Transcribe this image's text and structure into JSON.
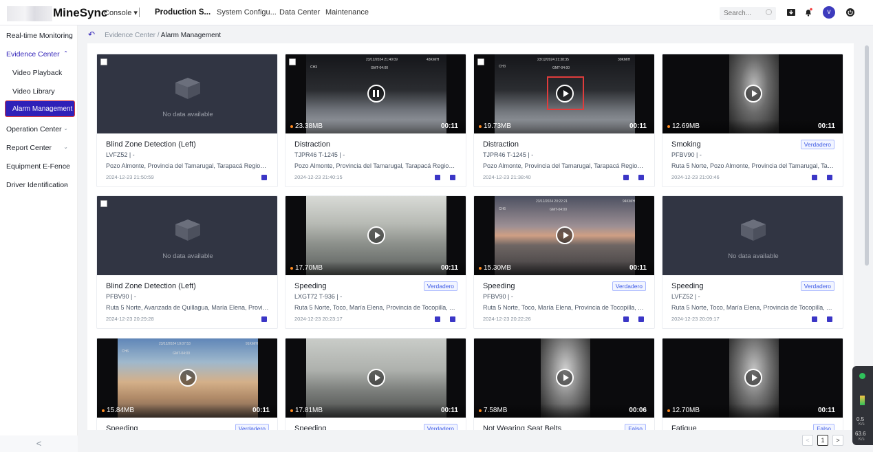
{
  "app": {
    "brand": "MineSync"
  },
  "topnav": {
    "console": "Console ▾",
    "production": "Production S...",
    "system": "System Configu...",
    "datacenter": "Data Center",
    "maintenance": "Maintenance",
    "search_placeholder": "Search...",
    "avatar": "v"
  },
  "sidebar": {
    "items": [
      {
        "label": "Real-time Monitoring"
      },
      {
        "label": "Evidence Center"
      },
      {
        "label": "Video Playback"
      },
      {
        "label": "Video Library"
      },
      {
        "label": "Alarm Management"
      },
      {
        "label": "Operation Center"
      },
      {
        "label": "Report Center"
      },
      {
        "label": "Equipment E-Fence"
      },
      {
        "label": "Driver Identification"
      }
    ],
    "collapse": "<"
  },
  "breadcrumb": {
    "parent": "Evidence Center",
    "sep": "/",
    "current": "Alarm Management"
  },
  "cards": [
    {
      "title": "Blind Zone Detection (Left)",
      "plate": "LVFZ52  |  -",
      "loc": "Pozo Almonte, Provincia del Tamarugal, Tarapacá Region, Ch...",
      "time": "2024-12-23 21:50:59",
      "nodata": "No data available"
    },
    {
      "title": "Distraction",
      "plate": "TJPR46 T-1245  |  -",
      "loc": "Pozo Almonte, Provincia del Tamarugal, Tarapacá Region, Ch...",
      "time": "2024-12-23 21:40:15",
      "size": "23.38MB",
      "dur": "00:11"
    },
    {
      "title": "Distraction",
      "plate": "TJPR46 T-1245  |  -",
      "loc": "Pozo Almonte, Provincia del Tamarugal, Tarapacá Region, Ch...",
      "time": "2024-12-23 21:38:40",
      "size": "19.73MB",
      "dur": "00:11"
    },
    {
      "title": "Smoking",
      "plate": "PFBV90  |  -",
      "loc": "Ruta 5 Norte, Pozo Almonte, Provincia del Tamarugal, Tarapa...",
      "time": "2024-12-23 21:00:46",
      "size": "12.69MB",
      "dur": "00:11",
      "badge": "Verdadero"
    },
    {
      "title": "Blind Zone Detection (Left)",
      "plate": "PFBV90  |  -",
      "loc": "Ruta 5 Norte, Avanzada de Quillagua, María Elena, Provincia ...",
      "time": "2024-12-23 20:29:28",
      "nodata": "No data available"
    },
    {
      "title": "Speeding",
      "plate": "LXGT72 T-936  |  -",
      "loc": "Ruta 5 Norte, Toco, María Elena, Provincia de Tocopilla, Anto...",
      "time": "2024-12-23 20:23:17",
      "size": "17.70MB",
      "dur": "00:11",
      "badge": "Verdadero"
    },
    {
      "title": "Speeding",
      "plate": "PFBV90  |  -",
      "loc": "Ruta 5 Norte, Toco, María Elena, Provincia de Tocopilla, Anto...",
      "time": "2024-12-23 20:22:26",
      "size": "15.30MB",
      "dur": "00:11",
      "badge": "Verdadero"
    },
    {
      "title": "Speeding",
      "plate": "LVFZ52  |  -",
      "loc": "Ruta 5 Norte, Toco, María Elena, Provincia de Tocopilla, Anto...",
      "time": "2024-12-23 20:09:17",
      "nodata": "No data available",
      "badge": "Verdadero"
    },
    {
      "title": "Speeding",
      "size": "15.84MB",
      "dur": "00:11",
      "badge": "Verdadero"
    },
    {
      "title": "Speeding",
      "size": "17.81MB",
      "dur": "00:11",
      "badge": "Verdadero"
    },
    {
      "title": "Not Wearing Seat Belts",
      "size": "7.58MB",
      "dur": "00:06",
      "badge": "Falso"
    },
    {
      "title": "Fatigue",
      "size": "12.70MB",
      "dur": "00:11",
      "badge": "Falso"
    }
  ],
  "osd": {
    "c2": {
      "date": "23/12/2024 21:40:09",
      "gmt": "GMT-04:00",
      "ch": "CH3",
      "spd": "43KM/H"
    },
    "c3": {
      "date": "23/12/2024 21:38:35",
      "gmt": "GMT-04:00",
      "ch": "CH3",
      "spd": "30KM/H"
    },
    "c6": {
      "date": "23/12/2024 20:22:21",
      "gmt": "GMT-04:00",
      "ch": "CH6",
      "spd": "94KM/H"
    },
    "c9": {
      "date": "23/12/2024 19:07:53",
      "gmt": "GMT-04:00",
      "ch": "CH6",
      "spd": "91KM/H"
    }
  },
  "pager": {
    "prev": "<",
    "page": "1",
    "next": ">"
  },
  "widget": {
    "v1": "0.5",
    "u1": "K/s",
    "v2": "63.6",
    "u2": "K/s"
  },
  "colors": {
    "primary": "#2f20b8",
    "highlight": "#e03c3c",
    "size_dot": "#ff8a1f"
  }
}
